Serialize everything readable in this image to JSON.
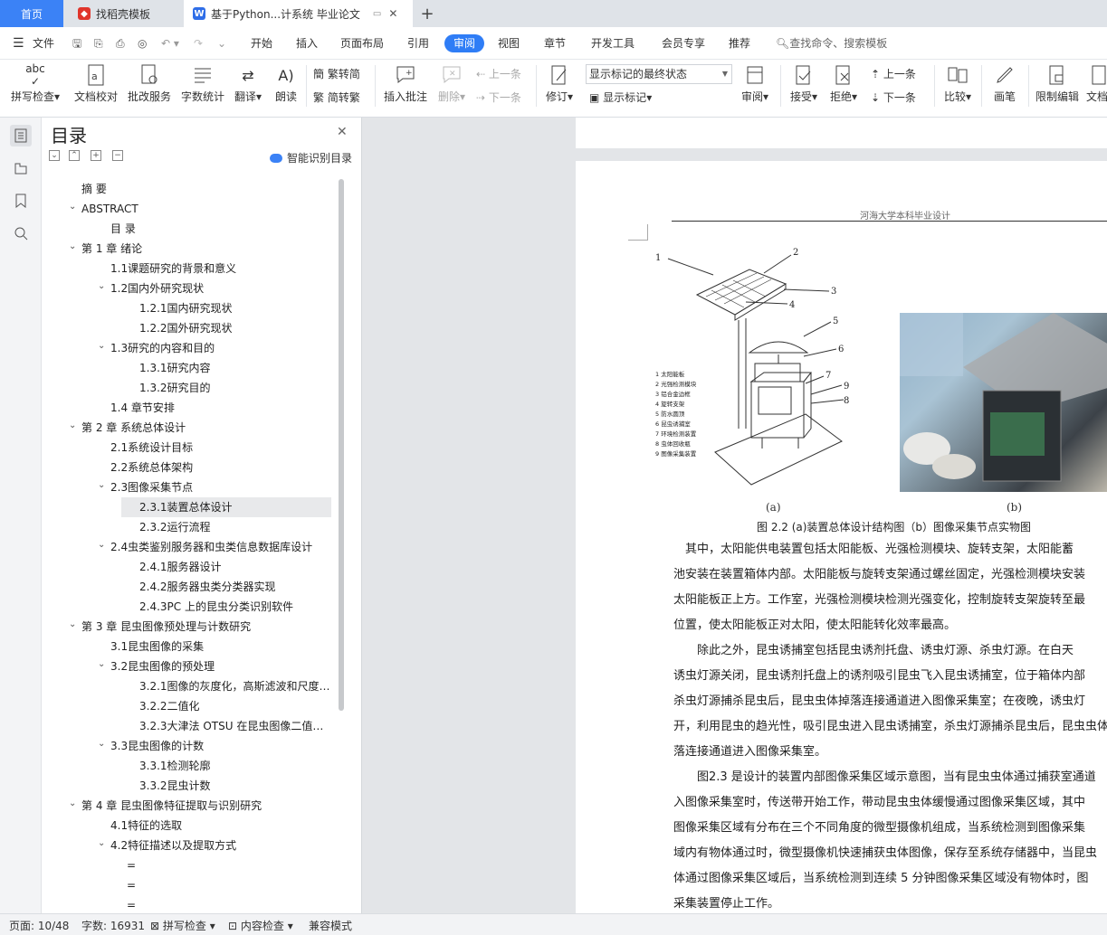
{
  "tabs": {
    "home": "首页",
    "daoke": "找稻壳模板",
    "doc": "基于Python...计系统 毕业论文"
  },
  "menu": {
    "file": "文件",
    "items": [
      "开始",
      "插入",
      "页面布局",
      "引用",
      "审阅",
      "视图",
      "章节",
      "开发工具",
      "会员专享",
      "推荐"
    ],
    "active": "审阅",
    "search": "查找命令、搜索模板"
  },
  "ribbon": {
    "spell": "拼写检查",
    "proof": "文档校对",
    "batch": "批改服务",
    "wordcount": "字数统计",
    "translate": "翻译",
    "read": "朗读",
    "to_trad": "繁转简",
    "to_simp": "简转繁",
    "insert_comment": "插入批注",
    "delete": "删除",
    "prev": "上一条",
    "next": "下一条",
    "revise": "修订",
    "markup_select": "显示标记的最终状态",
    "show_markup": "显示标记",
    "review": "审阅",
    "accept": "接受",
    "reject": "拒绝",
    "prev2": "上一条",
    "next2": "下一条",
    "compare": "比较",
    "pen": "画笔",
    "restrict": "限制编辑",
    "doc_rights": "文档"
  },
  "toc": {
    "title": "目录",
    "smart": "智能识别目录",
    "items": [
      {
        "text": "摘 要",
        "level": 0,
        "chev": ""
      },
      {
        "text": "ABSTRACT",
        "level": 0,
        "chev": "v"
      },
      {
        "text": "目 录",
        "level": 1,
        "chev": ""
      },
      {
        "text": "第 1 章 绪论",
        "level": 0,
        "chev": "v"
      },
      {
        "text": "1.1课题研究的背景和意义",
        "level": 1,
        "chev": ""
      },
      {
        "text": "1.2国内外研究现状",
        "level": 1,
        "chev": "v"
      },
      {
        "text": "1.2.1国内研究现状",
        "level": 2,
        "chev": ""
      },
      {
        "text": "1.2.2国外研究现状",
        "level": 2,
        "chev": ""
      },
      {
        "text": "1.3研究的内容和目的",
        "level": 1,
        "chev": "v"
      },
      {
        "text": "1.3.1研究内容",
        "level": 2,
        "chev": ""
      },
      {
        "text": "1.3.2研究目的",
        "level": 2,
        "chev": ""
      },
      {
        "text": "1.4 章节安排",
        "level": 1,
        "chev": ""
      },
      {
        "text": "第 2 章 系统总体设计",
        "level": 0,
        "chev": "v"
      },
      {
        "text": "2.1系统设计目标",
        "level": 1,
        "chev": ""
      },
      {
        "text": "2.2系统总体架构",
        "level": 1,
        "chev": ""
      },
      {
        "text": "2.3图像采集节点",
        "level": 1,
        "chev": "v"
      },
      {
        "text": "2.3.1装置总体设计",
        "level": 2,
        "chev": "",
        "selected": true
      },
      {
        "text": "2.3.2运行流程",
        "level": 2,
        "chev": ""
      },
      {
        "text": "2.4虫类鉴别服务器和虫类信息数据库设计",
        "level": 1,
        "chev": "v"
      },
      {
        "text": "2.4.1服务器设计",
        "level": 2,
        "chev": ""
      },
      {
        "text": "2.4.2服务器虫类分类器实现",
        "level": 2,
        "chev": ""
      },
      {
        "text": "2.4.3PC 上的昆虫分类识别软件",
        "level": 2,
        "chev": ""
      },
      {
        "text": "第 3 章 昆虫图像预处理与计数研究",
        "level": 0,
        "chev": "v"
      },
      {
        "text": "3.1昆虫图像的采集",
        "level": 1,
        "chev": ""
      },
      {
        "text": "3.2昆虫图像的预处理",
        "level": 1,
        "chev": "v"
      },
      {
        "text": "3.2.1图像的灰度化，高斯滤波和尺度 ...",
        "level": 2,
        "chev": ""
      },
      {
        "text": "3.2.2二值化",
        "level": 2,
        "chev": ""
      },
      {
        "text": "3.2.3大津法 OTSU 在昆虫图像二值化...",
        "level": 2,
        "chev": ""
      },
      {
        "text": "3.3昆虫图像的计数",
        "level": 1,
        "chev": "v"
      },
      {
        "text": "3.3.1检测轮廓",
        "level": 2,
        "chev": ""
      },
      {
        "text": "3.3.2昆虫计数",
        "level": 2,
        "chev": ""
      },
      {
        "text": "第 4 章 昆虫图像特征提取与识别研究",
        "level": 0,
        "chev": "v"
      },
      {
        "text": "4.1特征的选取",
        "level": 1,
        "chev": ""
      },
      {
        "text": "4.2特征描述以及提取方式",
        "level": 1,
        "chev": "v"
      },
      {
        "text": "=",
        "level": 3,
        "chev": ""
      },
      {
        "text": "=",
        "level": 3,
        "chev": ""
      },
      {
        "text": "=",
        "level": 3,
        "chev": ""
      }
    ]
  },
  "doc": {
    "header": "河海大学本科毕业设计",
    "fig_labels": {
      "n1": "1",
      "n2": "2",
      "n3": "3",
      "n4": "4",
      "n5": "5",
      "n6": "6",
      "n7": "7",
      "n8": "8",
      "n9": "9"
    },
    "legend": [
      "1 太阳能板",
      "2 光强检测模块",
      "3 铝合金边框",
      "4 旋转支架",
      "5 防水圆顶",
      "6 昆虫诱捕室",
      "7 环境检测装置",
      "8 虫体回收瓶",
      "9 图像采集装置"
    ],
    "cap_a": "(a)",
    "cap_b": "(b)",
    "figcap": "图 2.2 (a)装置总体设计结构图（b）图像采集节点实物图",
    "paras": [
      "　其中，太阳能供电装置包括太阳能板、光强检测模块、旋转支架，太阳能蓄",
      "池安装在装置箱体内部。太阳能板与旋转支架通过螺丝固定，光强检测模块安装",
      "太阳能板正上方。工作室，光强检测模块检测光强变化，控制旋转支架旋转至最",
      "位置，使太阳能板正对太阳，使太阳能转化效率最高。",
      "　　除此之外，昆虫诱捕室包括昆虫诱剂托盘、诱虫灯源、杀虫灯源。在白天",
      "诱虫灯源关闭，昆虫诱剂托盘上的诱剂吸引昆虫飞入昆虫诱捕室，位于箱体内部",
      "杀虫灯源捕杀昆虫后，昆虫虫体掉落连接通道进入图像采集室；在夜晚，诱虫灯",
      "开，利用昆虫的趋光性，吸引昆虫进入昆虫诱捕室，杀虫灯源捕杀昆虫后，昆虫虫体",
      "落连接通道进入图像采集室。",
      "　　图2.3 是设计的装置内部图像采集区域示意图，当有昆虫虫体通过捕获室通道",
      "入图像采集室时，传送带开始工作，带动昆虫虫体缓慢通过图像采集区域，其中",
      "图像采集区域有分布在三个不同角度的微型摄像机组成，当系统检测到图像采集",
      "域内有物体通过时，微型摄像机快速捕获虫体图像，保存至系统存储器中，当昆虫",
      "体通过图像采集区域后，当系统检测到连续 5 分钟图像采集区域没有物体时，图",
      "采集装置停止工作。"
    ]
  },
  "status": {
    "page": "页面: 10/48",
    "words": "字数: 16931",
    "spell": "拼写检查",
    "content": "内容检查",
    "compat": "兼容模式"
  }
}
